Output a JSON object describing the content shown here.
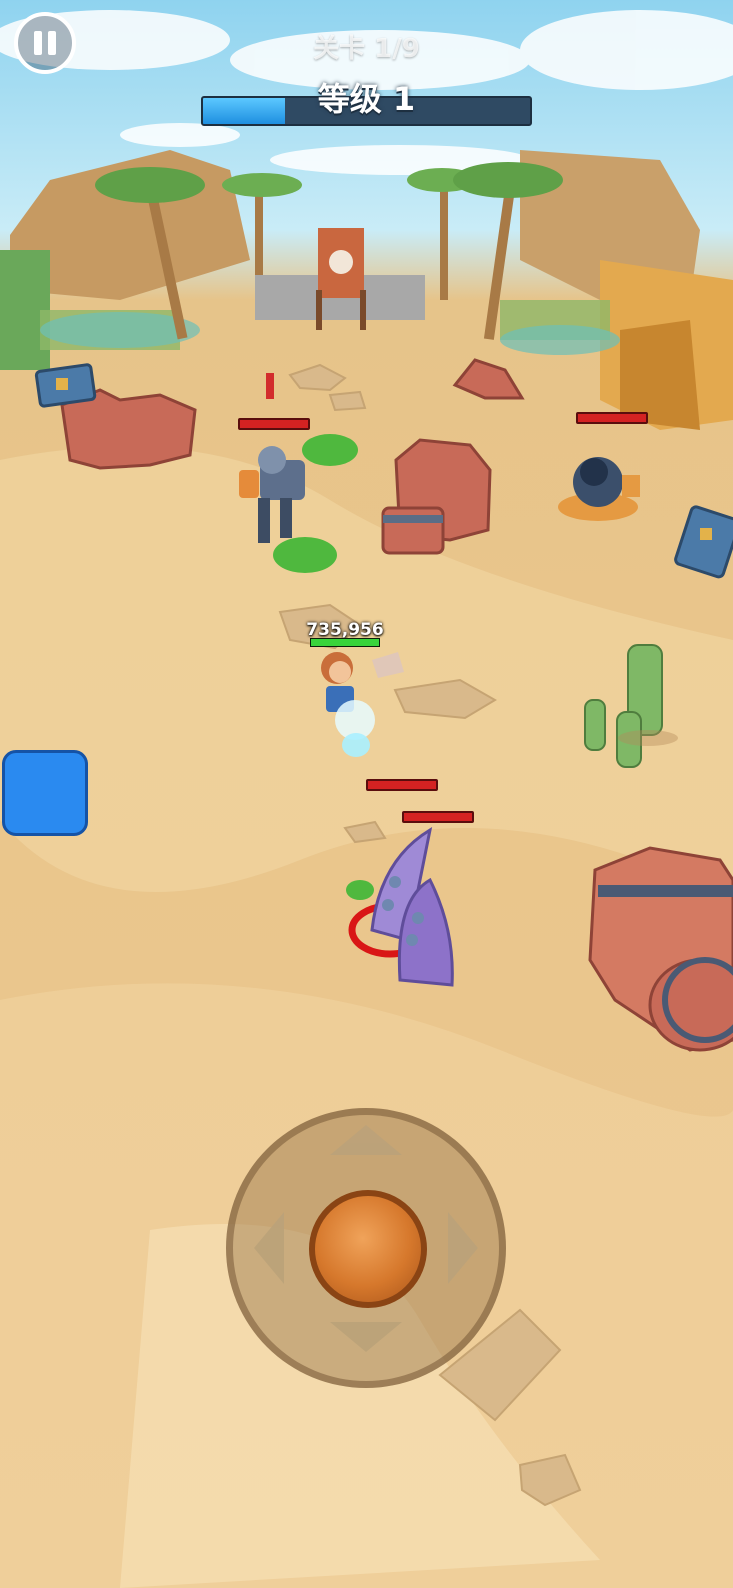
{
  "hud": {
    "stage_label": "关卡 1/9",
    "level_label": "等级 1",
    "xp_progress": 0.25,
    "pause_icon": "pause-icon"
  },
  "player": {
    "hp_text": "735,956",
    "hp_fraction": 1.0
  },
  "enemies": [
    {
      "name": "armored-knight",
      "hp_fraction": 1.0
    },
    {
      "name": "cannon-turret",
      "hp_fraction": 1.0
    },
    {
      "name": "purple-tentacle",
      "hp_fraction": 1.0
    },
    {
      "name": "purple-tentacle-2",
      "hp_fraction": 1.0
    }
  ],
  "controls": {
    "joystick_arrows": [
      "up-arrow-icon",
      "down-arrow-icon",
      "left-arrow-icon",
      "right-arrow-icon"
    ],
    "skill_button_color": "#2a8af0"
  },
  "colors": {
    "sand": "#e9c58b",
    "sky": "#8fd3ef",
    "xp_fill": "#2ea4f0",
    "enemy_hp": "#d42222",
    "player_hp": "#39d43b",
    "joystick_knob": "#d6782c"
  }
}
